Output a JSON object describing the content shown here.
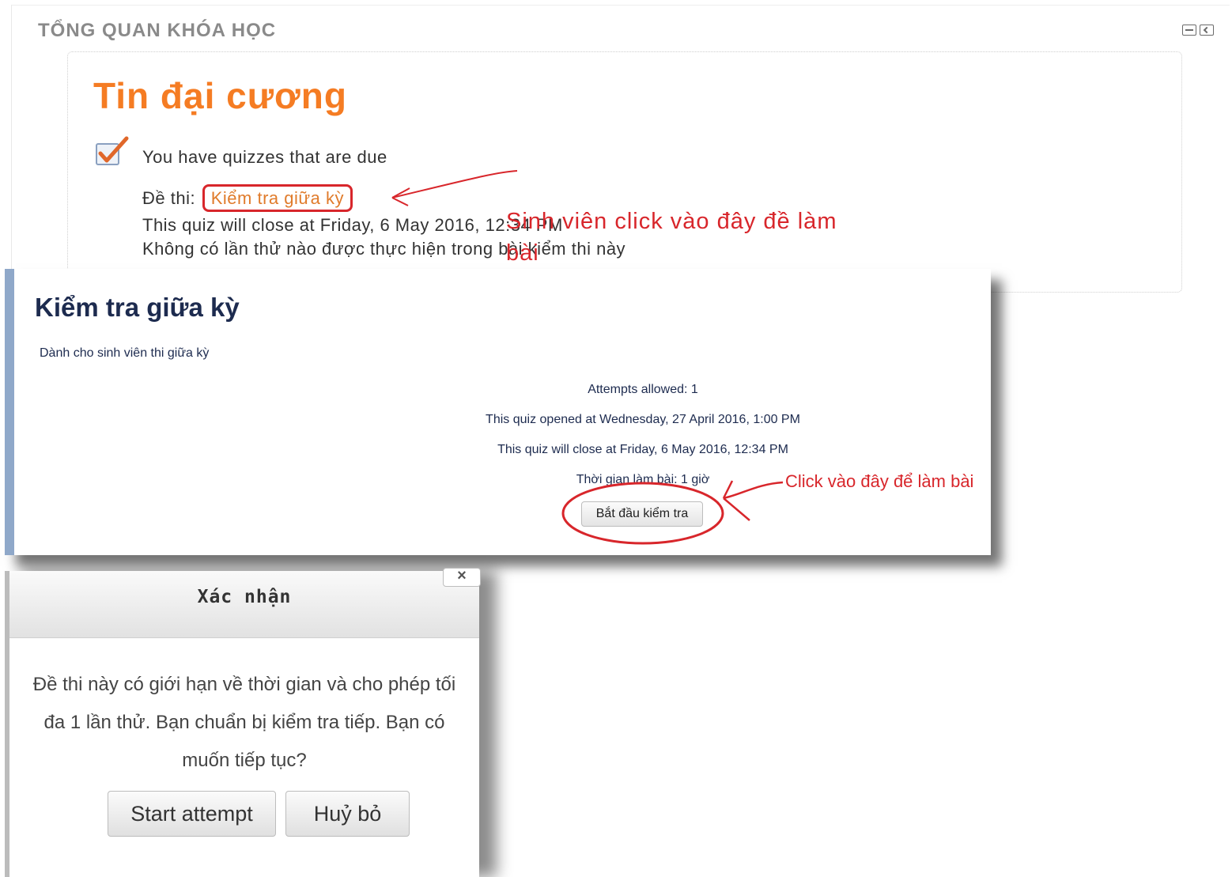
{
  "overview": {
    "title": "TỔNG QUAN KHÓA HỌC",
    "course_name": "Tin đại cương",
    "due_notice": "You have quizzes that are due",
    "quiz_prefix": "Đề thi:",
    "quiz_link": "Kiểm tra giữa kỳ",
    "close_info": "This quiz will close at Friday, 6 May 2016, 12:34 PM",
    "attempt_info": "Không có lần thử nào được thực hiện trong bài kiểm thi này",
    "annotation": "Sinh viên click vào đây đề làm bài"
  },
  "quiz_page": {
    "title": "Kiểm tra giữa kỳ",
    "intro": "Dành cho sinh viên thi giữa kỳ",
    "attempts_allowed": "Attempts allowed: 1",
    "opened": "This quiz opened at Wednesday, 27 April 2016, 1:00 PM",
    "closes": "This quiz will close at Friday, 6 May 2016, 12:34 PM",
    "time_limit": "Thời gian làm bài: 1 giờ",
    "start_button": "Bắt đầu kiểm tra",
    "annotation": "Click vào đây để làm bài"
  },
  "dialog": {
    "title": "Xác nhận",
    "close": "×",
    "message": "Đề thi này có giới hạn về thời gian và cho phép tối đa 1 lần thử. Bạn chuẩn bị kiểm tra tiếp. Bạn có muốn tiếp tục?",
    "confirm_button": "Start attempt",
    "cancel_button": "Huỷ bỏ"
  },
  "colors": {
    "course_orange": "#f57c23",
    "annotation_red": "#d8262b",
    "quiz_navy": "#1d2b4f",
    "panel_border_blue": "#8fa8c9"
  },
  "icons": {
    "block_minimize": "minimize-icon",
    "block_dock": "dock-icon",
    "quiz_due": "checkbox-checked-icon",
    "dialog_close": "close-icon"
  }
}
